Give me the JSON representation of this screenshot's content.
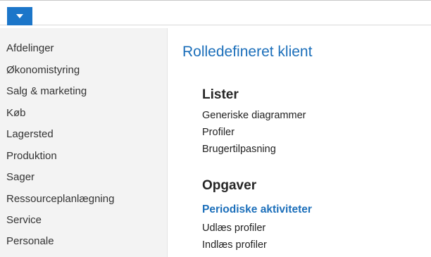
{
  "header": {
    "menu_icon": "chevron-down-icon",
    "accent_color": "#1c76c9"
  },
  "sidebar": {
    "items": [
      {
        "label": "Afdelinger"
      },
      {
        "label": "Økonomistyring"
      },
      {
        "label": "Salg & marketing"
      },
      {
        "label": "Køb"
      },
      {
        "label": "Lagersted"
      },
      {
        "label": "Produktion"
      },
      {
        "label": "Sager"
      },
      {
        "label": "Ressourceplanlægning"
      },
      {
        "label": "Service"
      },
      {
        "label": "Personale"
      }
    ]
  },
  "main": {
    "title": "Rolledefineret klient",
    "sections": [
      {
        "heading": "Lister",
        "links": [
          "Generiske diagrammer",
          "Profiler",
          "Brugertilpasning"
        ]
      },
      {
        "heading": "Opgaver",
        "subheading": "Periodiske aktiviteter",
        "links": [
          "Udlæs profiler",
          "Indlæs profiler"
        ]
      }
    ]
  }
}
